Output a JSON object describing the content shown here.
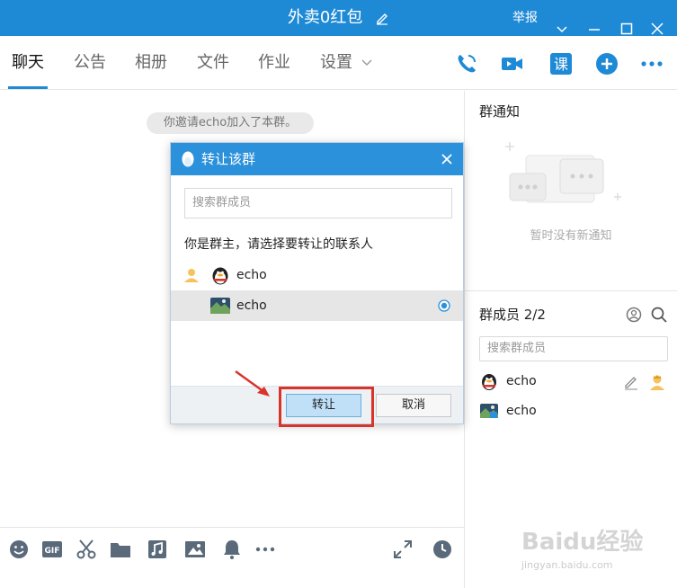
{
  "titlebar": {
    "title": "外卖0红包",
    "report": "举报"
  },
  "tabs": [
    "聊天",
    "公告",
    "相册",
    "文件",
    "作业",
    "设置"
  ],
  "chat": {
    "system_message": "你邀请echo加入了本群。"
  },
  "right_panel": {
    "notice_title": "群通知",
    "notice_empty": "暂时没有新通知",
    "members_title": "群成员 2/2",
    "search_placeholder": "搜索群成员",
    "members": [
      {
        "name": "echo"
      },
      {
        "name": "echo"
      }
    ]
  },
  "dialog": {
    "title": "转让该群",
    "search_placeholder": "搜索群成员",
    "hint": "你是群主，请选择要转让的联系人",
    "rows": [
      {
        "name": "echo"
      },
      {
        "name": "echo"
      }
    ],
    "ok_label": "转让",
    "cancel_label": "取消"
  },
  "watermark": {
    "brand": "Baidu经验",
    "url": "jingyan.baidu.com"
  },
  "colors": {
    "accent": "#1e8ad6",
    "highlight": "#d9342b"
  }
}
